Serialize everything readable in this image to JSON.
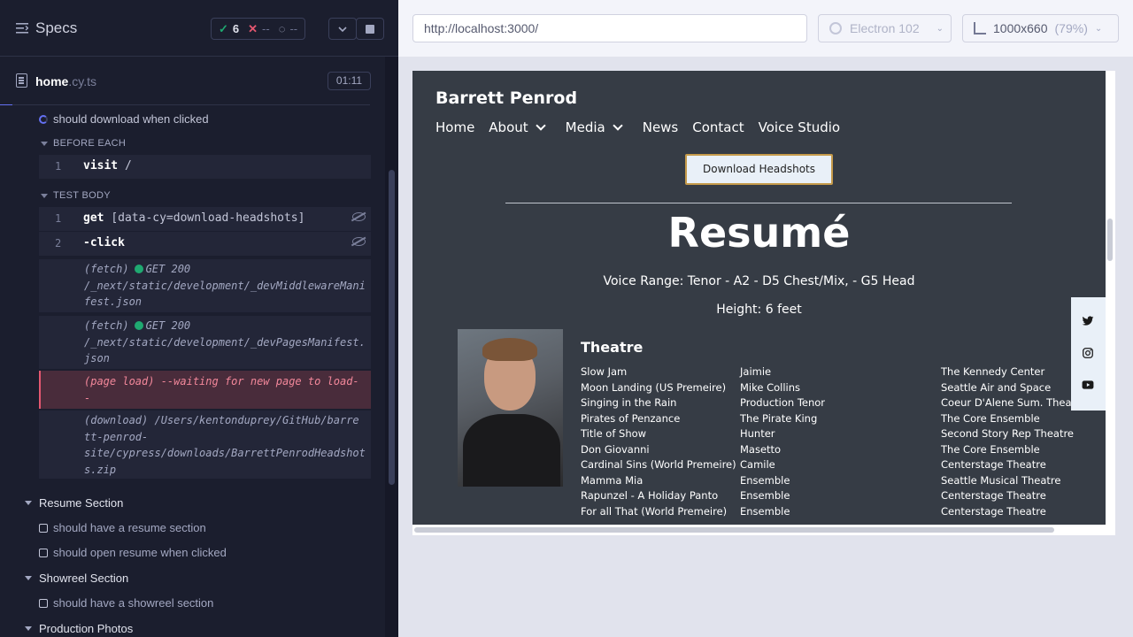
{
  "reporter": {
    "title": "Specs",
    "stats": {
      "passed": "6",
      "failed": "--",
      "pending": "--"
    },
    "spec": {
      "name": "home",
      "ext": ".cy.ts",
      "duration": "01:11"
    },
    "current_test": "should download when clicked",
    "before_each_label": "BEFORE EACH",
    "before_each": [
      {
        "num": "1",
        "cmd": "visit",
        "arg": "/"
      }
    ],
    "test_body_label": "TEST BODY",
    "test_body": [
      {
        "num": "1",
        "cmd": "get",
        "arg": "[data-cy=download-headshots]"
      },
      {
        "num": "2",
        "cmd": "-click",
        "arg": ""
      }
    ],
    "logs": {
      "fetch1_prefix": "(fetch)",
      "fetch1_status": "GET 200",
      "fetch1_line2": "/_next/static/development/_devMiddlewareMani",
      "fetch1_line3": "fest.json",
      "fetch2_prefix": "(fetch)",
      "fetch2_status": "GET 200",
      "fetch2_line2": "/_next/static/development/_devPagesManifest.",
      "fetch2_line3": "json",
      "pageload_line1": "(page load)  --waiting for new page to load-",
      "pageload_line2": "-",
      "download_line1": "(download)  /Users/kentonduprey/GitHub/barre",
      "download_line2": "tt-penrod-",
      "download_line3": "site/cypress/downloads/BarrettPenrodHeadshot",
      "download_line4": "s.zip"
    },
    "suites": [
      {
        "title": "Resume Section",
        "tests": [
          "should have a resume section",
          "should open resume when clicked"
        ]
      },
      {
        "title": "Showreel Section",
        "tests": [
          "should have a showreel section"
        ]
      },
      {
        "title": "Production Photos",
        "tests": []
      }
    ]
  },
  "aut": {
    "url": "http://localhost:3000/",
    "browser": "Electron 102",
    "viewport": "1000x660",
    "scale": "(79%)"
  },
  "site": {
    "name": "Barrett Penrod",
    "nav": [
      "Home",
      "About",
      "Media",
      "News",
      "Contact",
      "Voice Studio"
    ],
    "download_button": "Download Headshots",
    "resume_title": "Resumé",
    "voice_range": "Voice Range: Tenor - A2 - D5 Chest/Mix, - G5 Head",
    "height": "Height: 6 feet",
    "theatre_title": "Theatre",
    "theatre": [
      [
        "Slow Jam",
        "Jaimie",
        "The Kennedy Center"
      ],
      [
        "Moon Landing (US Premeire)",
        "Mike Collins",
        "Seattle Air and Space"
      ],
      [
        "Singing in the Rain",
        "Production Tenor",
        "Coeur D'Alene Sum. Theatre"
      ],
      [
        "Pirates of Penzance",
        "The Pirate King",
        "The Core Ensemble"
      ],
      [
        "Title of Show",
        "Hunter",
        "Second Story Rep Theatre"
      ],
      [
        "Don Giovanni",
        "Masetto",
        "The Core Ensemble"
      ],
      [
        "Cardinal Sins (World Premeire)",
        "Camile",
        "Centerstage Theatre"
      ],
      [
        "Mamma Mia",
        "Ensemble",
        "Seattle Musical Theatre"
      ],
      [
        "Rapunzel - A Holiday Panto",
        "Ensemble",
        "Centerstage Theatre"
      ],
      [
        "For all That (World Premeire)",
        "Ensemble",
        "Centerstage Theatre"
      ]
    ],
    "social": [
      "twitter-icon",
      "instagram-icon",
      "youtube-icon"
    ]
  }
}
